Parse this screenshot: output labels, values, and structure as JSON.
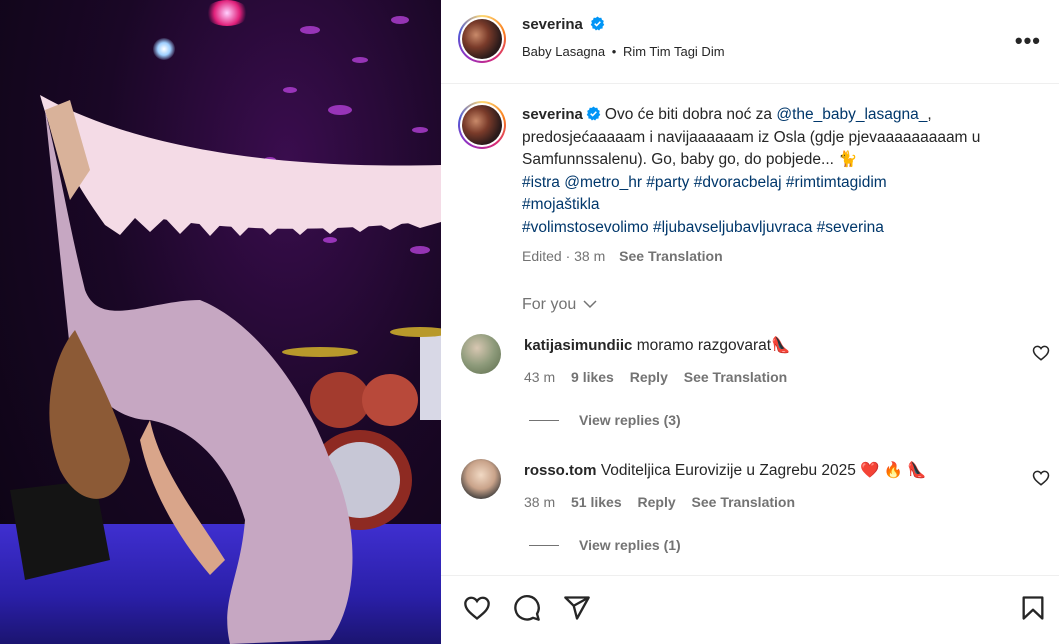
{
  "post": {
    "username": "severina",
    "subtitle_left": "Baby Lasagna",
    "subtitle_sep": "•",
    "subtitle_right": "Rim Tim Tagi Dim",
    "more_label": "•••"
  },
  "caption": {
    "username": "severina",
    "text_1": "Ovo će biti dobra noć za ",
    "mention_1": "@the_baby_lasagna_",
    "text_2": ", predosjećaaaaam i navijaaaaaam iz Osla (gdje pjevaaaaaaaaam u Samfunnssalenu). Go, baby go, do pobjede... 🐈",
    "tags_line_1": [
      "#istra",
      "@metro_hr",
      "#party",
      "#dvoracbelaj",
      "#rimtimtagidim"
    ],
    "tags_line_2": [
      "#mojaštikla"
    ],
    "tags_line_3": [
      "#volimstosevolimo",
      "#ljubavseljubavljuvraca",
      "#severina"
    ],
    "edited": "Edited · 38 m",
    "see_translation": "See Translation"
  },
  "for_you": "For you",
  "comments": [
    {
      "username": "katijasimundiic",
      "text": "moramo razgovarat👠",
      "time": "43 m",
      "likes": "9 likes",
      "reply": "Reply",
      "see_translation": "See Translation",
      "view_replies": "View replies (3)"
    },
    {
      "username": "rosso.tom",
      "text": "Voditeljica Eurovizije u Zagrebu 2025 ❤️ 🔥 👠",
      "time": "38 m",
      "likes": "51 likes",
      "reply": "Reply",
      "see_translation": "See Translation",
      "view_replies": "View replies (1)"
    }
  ],
  "colors": {
    "link": "#00376b",
    "muted": "#737373",
    "verified": "#0095f6"
  },
  "icons": {
    "like": "heart-icon",
    "comment": "comment-icon",
    "share": "paper-plane-icon",
    "save": "bookmark-icon"
  }
}
